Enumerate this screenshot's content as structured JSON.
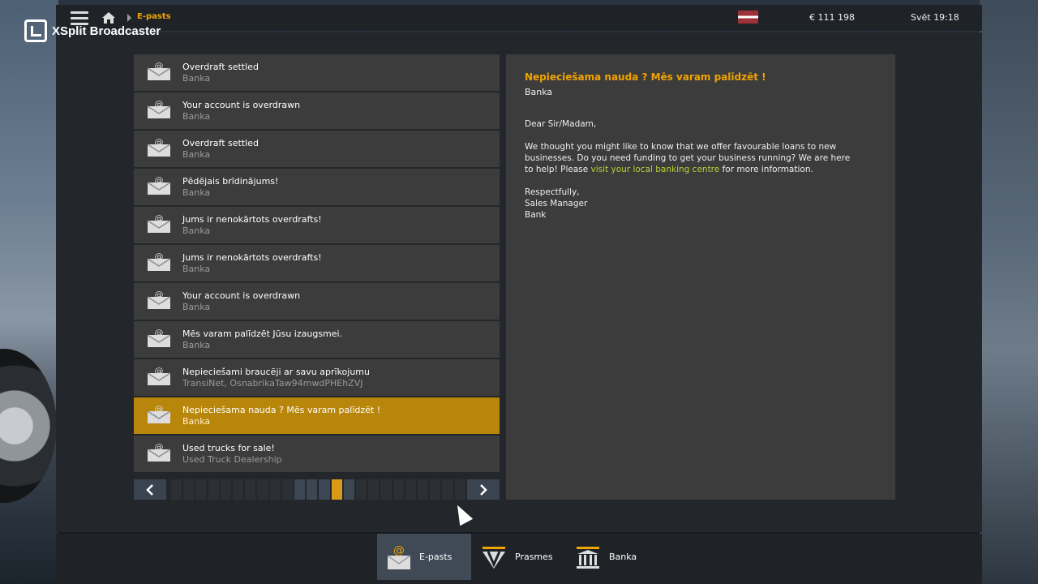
{
  "overlay": {
    "brand": "XSplit Broadcaster"
  },
  "topbar": {
    "breadcrumb": "E-pasts",
    "money": "€ 111 198",
    "time": "Svēt 19:18"
  },
  "mails": [
    {
      "title": "Overdraft settled",
      "sender": "Banka"
    },
    {
      "title": "Your account is overdrawn",
      "sender": "Banka"
    },
    {
      "title": "Overdraft settled",
      "sender": "Banka"
    },
    {
      "title": "Pēdējais brīdinājums!",
      "sender": "Banka"
    },
    {
      "title": "Jums ir nenokārtots overdrafts!",
      "sender": "Banka"
    },
    {
      "title": "Jums ir nenokārtots overdrafts!",
      "sender": "Banka"
    },
    {
      "title": "Your account is overdrawn",
      "sender": "Banka"
    },
    {
      "title": "Mēs varam palīdzēt Jūsu izaugsmei.",
      "sender": "Banka"
    },
    {
      "title": "Nepieciešami braucēji ar savu aprīkojumu",
      "sender": "TransiNet, OsnabrikaTaw94mwdPHEhZVJ"
    },
    {
      "title": "Nepieciešama nauda ? Mēs varam palīdzēt !",
      "sender": "Banka",
      "selected": true
    },
    {
      "title": "Used trucks for sale!",
      "sender": "Used Truck Dealership"
    }
  ],
  "pager": {
    "pages": 24,
    "current_page": 14
  },
  "reader": {
    "subject": "Nepieciešama nauda ? Mēs varam palīdzēt !",
    "from": "Banka",
    "greeting": "Dear Sir/Madam,",
    "body_start": "We thought you might like to know that we offer favourable loans to new businesses. Do you need funding to get your business running? We are here to help! Please ",
    "link": "visit your local banking centre",
    "body_end": " for more information.",
    "sign1": "Respectfully,",
    "sign2": "Sales Manager",
    "sign3": "Bank"
  },
  "tabs": [
    {
      "label": "E-pasts",
      "icon": "mail-icon",
      "active": true
    },
    {
      "label": "Prasmes",
      "icon": "skills-icon"
    },
    {
      "label": "Banka",
      "icon": "bank-icon"
    }
  ],
  "colors": {
    "accent": "#f0a400",
    "selected_row": "#b8860b",
    "link": "#b5d334"
  }
}
